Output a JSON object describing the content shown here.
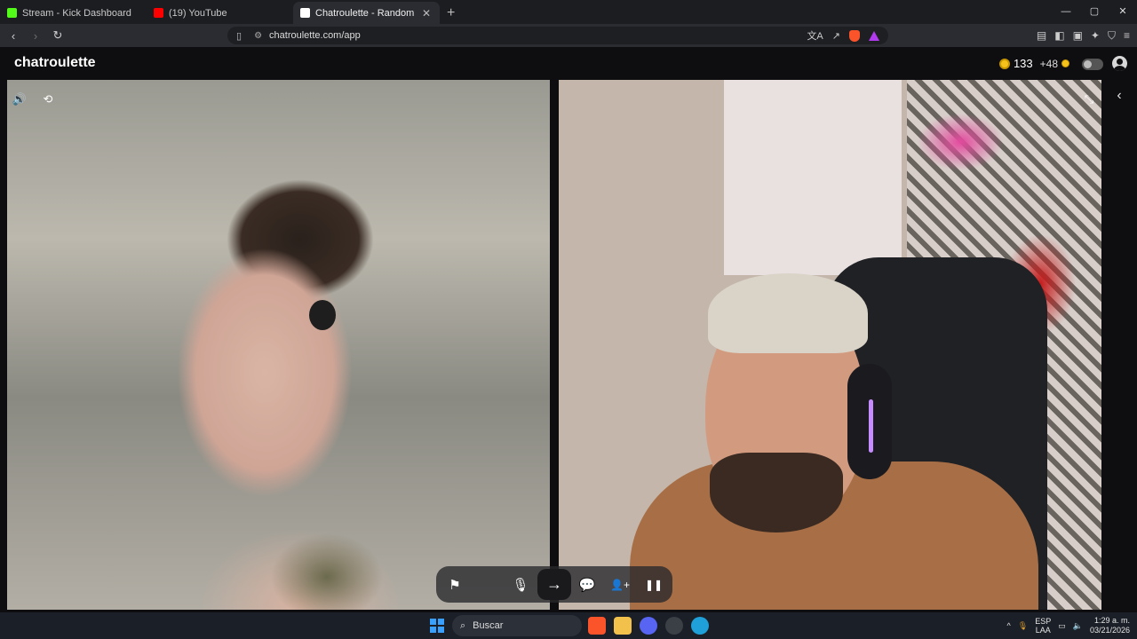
{
  "browser": {
    "tabs": [
      {
        "title": "Stream - Kick Dashboard",
        "fav_color": "#53fc18"
      },
      {
        "title": "(19) YouTube",
        "fav_color": "#ff0000"
      },
      {
        "title": "Chatroulette - Random video",
        "fav_color": "#ffffff",
        "active": true
      }
    ],
    "tab_close": "✕",
    "new_tab": "+",
    "window_controls": {
      "minimize": "—",
      "maximize": "▢",
      "close": "✕"
    },
    "back": "‹",
    "forward": "›",
    "reload": "↻",
    "url": "chatroulette.com/app",
    "bookmark_icon": "🔖",
    "translate_icon": "文A",
    "share_icon": "↗"
  },
  "app": {
    "logo": "chatroulette",
    "coins": "133",
    "bonus": "+48",
    "toggle_state": "off"
  },
  "left_video": {
    "sound_icon": "🔊",
    "camera_switch_icon": "⟲"
  },
  "right_video": {
    "minimize_icon": "⤡"
  },
  "sidebar": {
    "collapse_icon": "‹"
  },
  "controls": {
    "report_icon": "⚑",
    "mic_icon": "🎙",
    "next_icon": "→",
    "chat_icon": "💬",
    "add_friend_icon": "👤+",
    "pause_icon": "❚❚"
  },
  "taskbar": {
    "search_placeholder": "Buscar",
    "lang_1": "ESP",
    "lang_2": "LAA",
    "time": "1:29 a. m.",
    "date": "03/21/2026",
    "chevron_up": "^"
  }
}
